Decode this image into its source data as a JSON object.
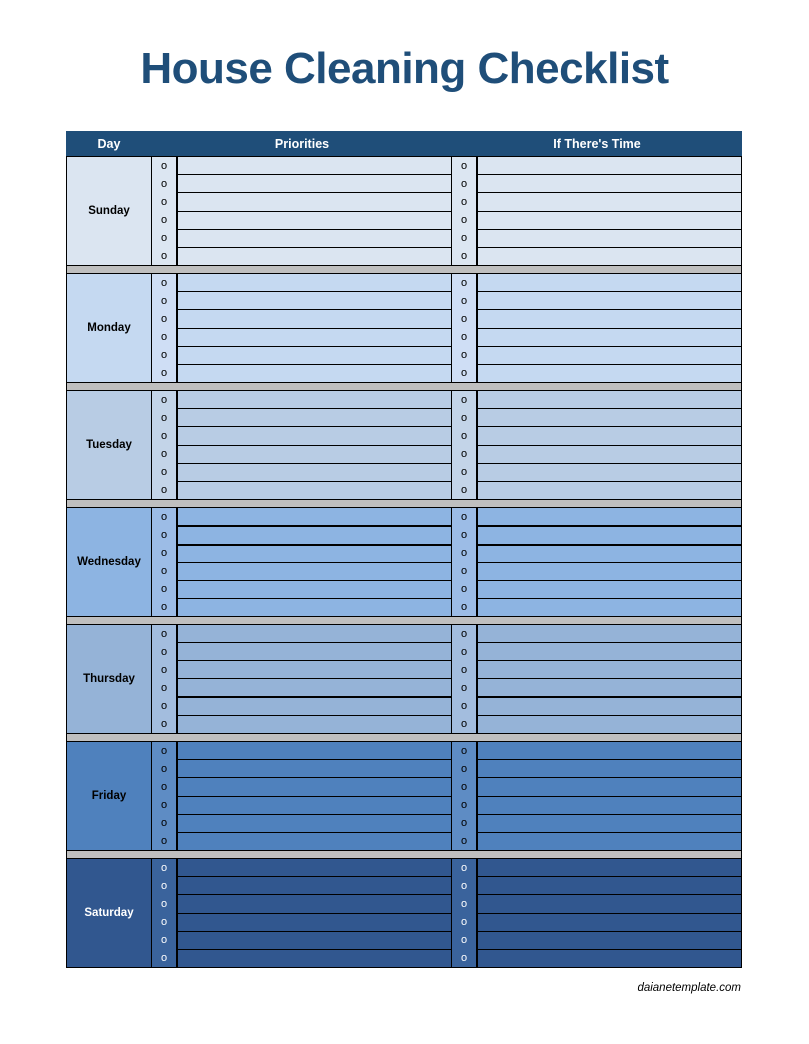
{
  "document": {
    "title": "House Cleaning Checklist",
    "footer": "daianetemplate.com"
  },
  "colors": {
    "header_bg": "#1f4e79",
    "title_color": "#1f4e79",
    "separator": "#bfbfbf",
    "grid_line": "#000000"
  },
  "table": {
    "headers": {
      "day": "Day",
      "priorities": "Priorities",
      "if_theres_time": "If There's Time"
    },
    "marker_glyph": "o",
    "rows_per_day": 6,
    "days": [
      {
        "name": "Sunday",
        "bg": "#dbe5f1",
        "marks_bg": "#dce6f2",
        "text_color": "#000000",
        "mark_color": "#000000",
        "priorities": [
          "",
          "",
          "",
          "",
          "",
          ""
        ],
        "if_theres_time": [
          "",
          "",
          "",
          "",
          "",
          ""
        ],
        "thick_lines": []
      },
      {
        "name": "Monday",
        "bg": "#c5d9f1",
        "marks_bg": "#cfdef5",
        "text_color": "#000000",
        "mark_color": "#000000",
        "priorities": [
          "",
          "",
          "",
          "",
          "",
          ""
        ],
        "if_theres_time": [
          "",
          "",
          "",
          "",
          "",
          ""
        ],
        "thick_lines": []
      },
      {
        "name": "Tuesday",
        "bg": "#b8cce4",
        "marks_bg": "#c3d4e8",
        "text_color": "#000000",
        "mark_color": "#000000",
        "priorities": [
          "",
          "",
          "",
          "",
          "",
          ""
        ],
        "if_theres_time": [
          "",
          "",
          "",
          "",
          "",
          ""
        ],
        "thick_lines": []
      },
      {
        "name": "Wednesday",
        "bg": "#8db4e2",
        "marks_bg": "#9cbce6",
        "text_color": "#000000",
        "mark_color": "#000000",
        "priorities": [
          "",
          "",
          "",
          "",
          "",
          ""
        ],
        "if_theres_time": [
          "",
          "",
          "",
          "",
          "",
          ""
        ],
        "thick_lines": [
          0,
          1
        ]
      },
      {
        "name": "Thursday",
        "bg": "#95b3d7",
        "marks_bg": "#a3bdde",
        "text_color": "#000000",
        "mark_color": "#000000",
        "priorities": [
          "",
          "",
          "",
          "",
          "",
          ""
        ],
        "if_theres_time": [
          "",
          "",
          "",
          "",
          "",
          ""
        ],
        "thick_lines": [
          3
        ]
      },
      {
        "name": "Friday",
        "bg": "#4f81bd",
        "marks_bg": "#5e8cc4",
        "text_color": "#000000",
        "mark_color": "#000000",
        "priorities": [
          "",
          "",
          "",
          "",
          "",
          ""
        ],
        "if_theres_time": [
          "",
          "",
          "",
          "",
          "",
          ""
        ],
        "thick_lines": []
      },
      {
        "name": "Saturday",
        "bg": "#31578f",
        "marks_bg": "#3a639c",
        "text_color": "#ffffff",
        "mark_color": "#ffffff",
        "priorities": [
          "",
          "",
          "",
          "",
          "",
          ""
        ],
        "if_theres_time": [
          "",
          "",
          "",
          "",
          "",
          ""
        ],
        "thick_lines": []
      }
    ]
  }
}
